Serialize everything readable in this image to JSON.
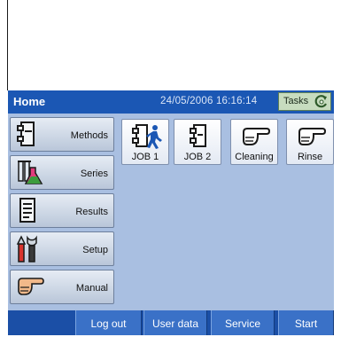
{
  "header": {
    "title": "Home",
    "datetime": "24/05/2006 16:16:14",
    "tasks_label": "Tasks"
  },
  "sidebar": {
    "items": [
      {
        "label": "Methods",
        "icon": "method-document-icon"
      },
      {
        "label": "Series",
        "icon": "beakers-icon"
      },
      {
        "label": "Results",
        "icon": "results-document-icon"
      },
      {
        "label": "Setup",
        "icon": "tools-icon"
      },
      {
        "label": "Manual",
        "icon": "pointing-hand-icon"
      }
    ]
  },
  "shortcuts": [
    {
      "label": "JOB 1",
      "icon": "job-runner-icon"
    },
    {
      "label": "JOB 2",
      "icon": "job-document-icon"
    },
    {
      "label": "Cleaning",
      "icon": "pointing-hand-icon"
    },
    {
      "label": "Rinse",
      "icon": "pointing-hand-icon"
    }
  ],
  "bottom_bar": {
    "logout": "Log out",
    "user_data": "User data",
    "service": "Service",
    "start": "Start"
  },
  "colors": {
    "header_blue": "#1b57b4",
    "panel_bg": "#a9bfe1",
    "tasks_green": "#c7dcbf"
  }
}
